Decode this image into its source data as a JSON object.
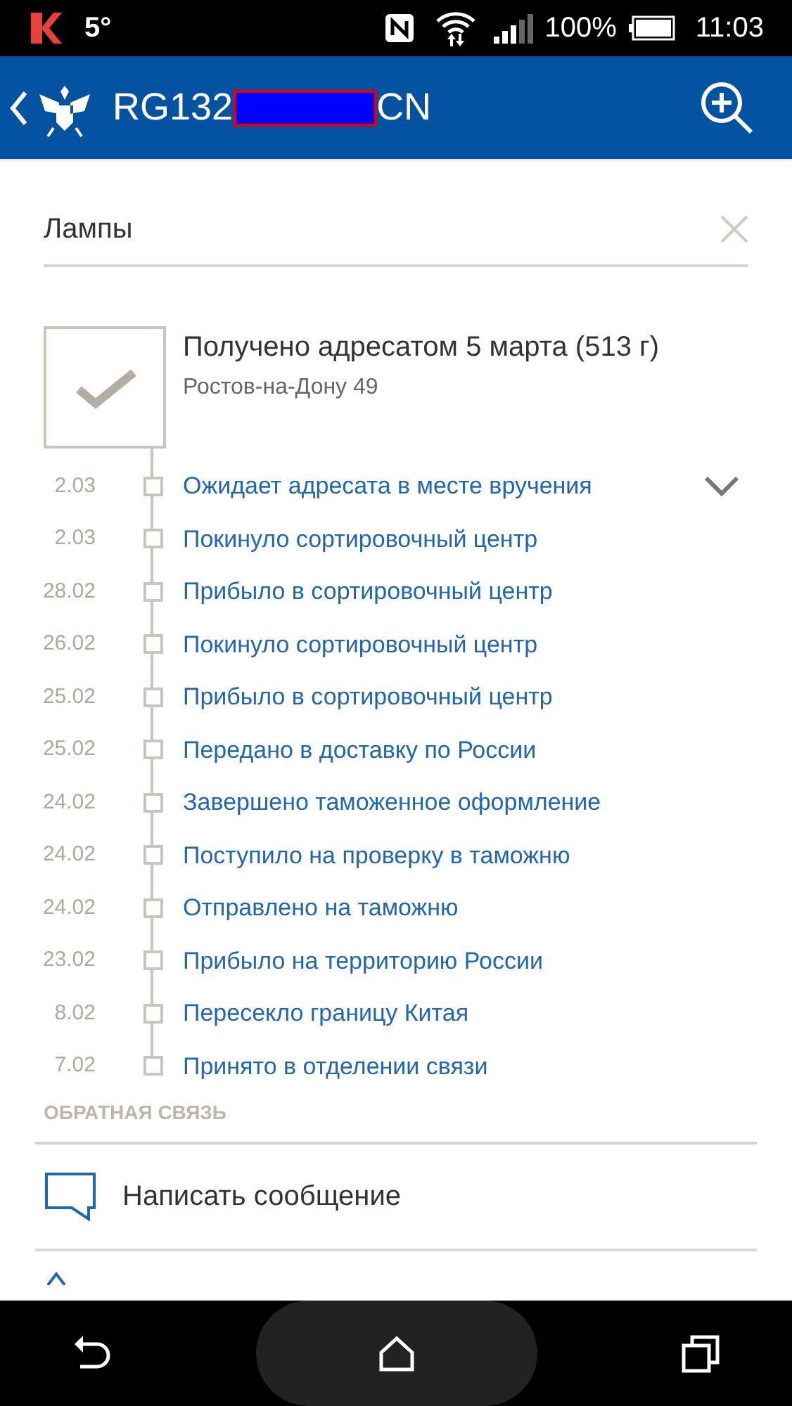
{
  "status_bar": {
    "temperature": "5°",
    "battery": "100%",
    "time": "11:03"
  },
  "app_bar": {
    "title_start": "RG132",
    "title_end": "CN",
    "redacted": true
  },
  "search": {
    "value": "Лампы"
  },
  "status": {
    "title": "Получено адресатом 5 марта (513 г)",
    "place": "Ростов-на-Дону 49",
    "delivered": true
  },
  "history": {
    "expanded": false,
    "events": [
      {
        "date": "2.03",
        "text": "Ожидает адресата в месте вручения"
      },
      {
        "date": "2.03",
        "text": "Покинуло сортировочный центр"
      },
      {
        "date": "28.02",
        "text": "Прибыло в сортировочный центр"
      },
      {
        "date": "26.02",
        "text": "Покинуло сортировочный центр"
      },
      {
        "date": "25.02",
        "text": "Прибыло в сортировочный центр"
      },
      {
        "date": "25.02",
        "text": "Передано в доставку по России"
      },
      {
        "date": "24.02",
        "text": "Завершено таможенное оформление"
      },
      {
        "date": "24.02",
        "text": "Поступило на проверку в таможню"
      },
      {
        "date": "24.02",
        "text": "Отправлено на таможню"
      },
      {
        "date": "23.02",
        "text": "Прибыло на территорию России"
      },
      {
        "date": "8.02",
        "text": "Пересекло границу Китая"
      },
      {
        "date": "7.02",
        "text": "Принято в отделении связи"
      }
    ]
  },
  "feedback": {
    "heading": "ОБРАТНАЯ СВЯЗЬ",
    "items": [
      {
        "label": "Написать сообщение"
      }
    ]
  }
}
